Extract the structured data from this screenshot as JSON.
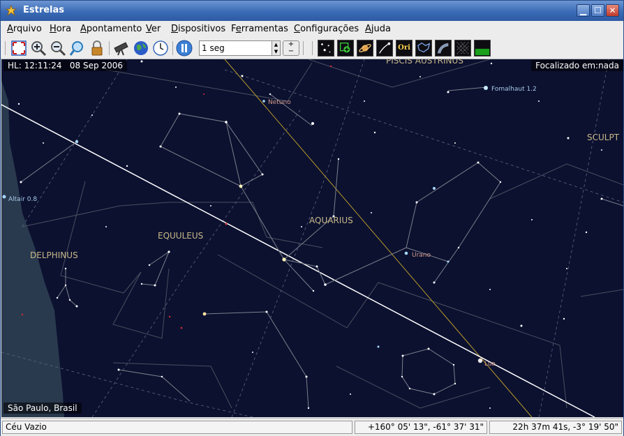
{
  "window": {
    "title": "Estrelas"
  },
  "menu": {
    "items": [
      {
        "first": "A",
        "rest": "rquivo"
      },
      {
        "first": "H",
        "rest": "ora"
      },
      {
        "first": "A",
        "rest": "pontamento"
      },
      {
        "first": "V",
        "rest": "er"
      },
      {
        "first": "D",
        "rest": "ispositivos"
      },
      {
        "pre": "F",
        "first": "e",
        "rest": "rramentas"
      },
      {
        "first": "C",
        "rest": "onfigurações"
      },
      {
        "first": "A",
        "rest": "juda"
      }
    ]
  },
  "toolbar": {
    "speed_value": "1 seg",
    "display_buttons": [
      "stars",
      "planets",
      "deep-sky",
      "comets",
      "Ori",
      "constellation-boundaries",
      "milky-way",
      "grid",
      "horizon"
    ],
    "ori_label": "Ori"
  },
  "sky": {
    "local_time_label": "HL: 12:11:24",
    "date_label": "08 Sep 2006",
    "focus_label": "Focalizado em:nada",
    "location_label": "São Paulo, Brasil",
    "constellations": [
      "PISCIS AUSTRINUS",
      "SCULPT",
      "AQUARIUS",
      "EQUULEUS",
      "DELPHINUS"
    ],
    "objects": [
      "Netuno",
      "Fomalhaut 1.2",
      "Altair 0.8",
      "Urano",
      "Lua"
    ]
  },
  "status": {
    "message": "Céu Vazio",
    "alt_az": "+160° 05' 13\",  -61° 37' 31\"",
    "ra_dec": "22h 37m 41s,  -3° 19' 50\""
  },
  "colors": {
    "sky_background": "#0c1130",
    "ground": "#2a3a4e",
    "constellation_label": "#c8b888",
    "object_label": "#d49a8a",
    "ecliptic": "#ffffff",
    "equator": "#b89a2a"
  }
}
